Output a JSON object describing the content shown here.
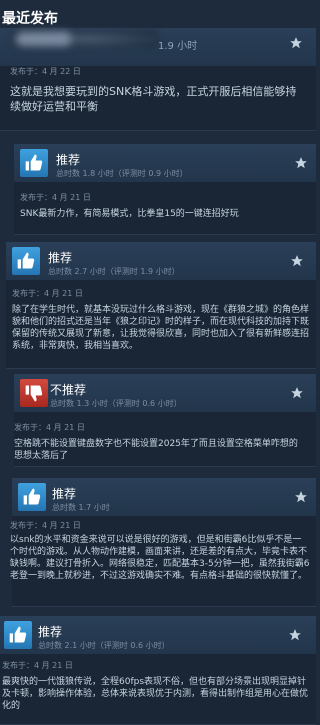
{
  "header": {
    "title": "最近发布"
  },
  "reviews": [
    {
      "verdict": "",
      "hours": "1.9 小时",
      "date": "发布于：4 月 22 日",
      "text": "这就是我想要玩到的SNK格斗游戏，正式开服后相信能够持续做好运营和平衡"
    },
    {
      "verdict": "推荐",
      "hours": "总时数 1.8 小时（评测时 0.9 小时）",
      "date": "发布于：4 月 21 日",
      "text": "SNK最新力作，有简易模式，比拳皇15的一键连招好玩"
    },
    {
      "verdict": "推荐",
      "hours": "总时数 2.7 小时（评测时 1.9 小时）",
      "date": "发布于：4 月 21 日",
      "text": "除了在学生时代，就基本没玩过什么格斗游戏，现在《群狼之城》的角色样貌和他们的招式还是当年《狼之印记》时的样子，而在现代科技的加持下既保留的传统又展现了新意，让我觉得很欣喜，同时也加入了很有新鲜感连招系统，非常爽快，我相当喜欢。"
    },
    {
      "verdict": "不推荐",
      "hours": "总时数 1.3 小时（评测时 0.6 小时）",
      "date": "发布于：4 月 21 日",
      "text": "空格跳不能设置键盘数字也不能设置2025年了而且设置空格菜单咋想的思想太落后了"
    },
    {
      "verdict": "推荐",
      "hours": "总时数 1.7 小时",
      "date": "发布于：4 月 21 日",
      "text": "以snk的水平和资金来说可以说是很好的游戏，但是和街霸6比似乎不是一个时代的游戏。从人物动作建模，画面来讲，还是差的有点大，毕竟卡表不缺钱啊。建议打骨折入。网络很稳定，匹配基本3-5分钟一把，虽然我街霸6老登一到晚上就秒进，不过这游戏确实不难。有点格斗基础的很快就懂了。"
    },
    {
      "verdict": "推荐",
      "hours": "总时数 2.1 小时（评测时 0.6 小时）",
      "date": "发布于：4 月 21 日",
      "text": "最爽快的一代饿狼传说，全程60fps表现不俗，但也有部分场景出现明显掉针及卡顿，影响操作体验，总体来说表现优于内测，看得出制作组是用心在做优化的"
    }
  ],
  "colors": {
    "recommend": "#2d7fc1",
    "not_recommend": "#b7362b",
    "star": "#c6d4df"
  },
  "icons": {
    "recommend": "thumbs-up-icon",
    "not_recommend": "thumbs-down-icon",
    "award": "star-icon"
  }
}
